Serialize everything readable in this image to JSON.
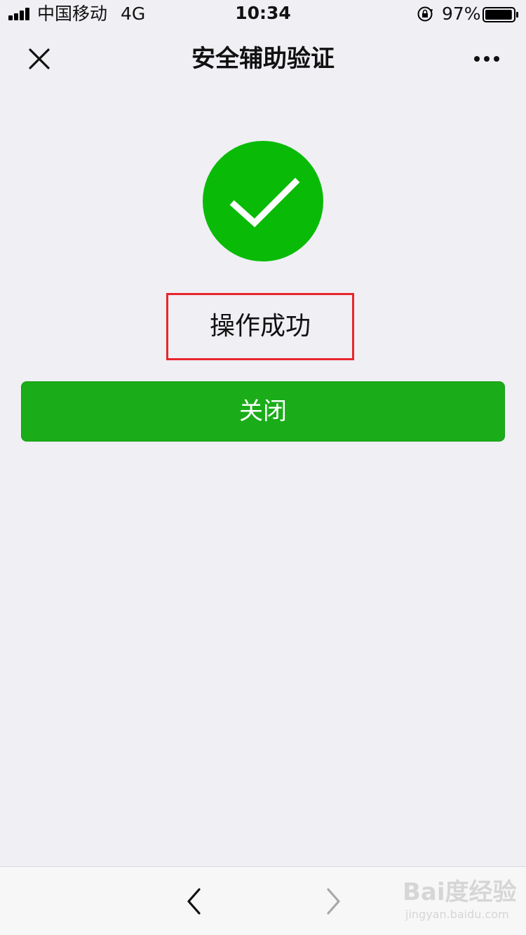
{
  "status_bar": {
    "carrier": "中国移动",
    "network": "4G",
    "time": "10:34",
    "battery_percent": "97%",
    "battery_level": 0.97
  },
  "nav": {
    "title": "安全辅助验证",
    "close_icon": "close-icon",
    "more_icon": "more-icon"
  },
  "result": {
    "icon": "success-check-icon",
    "message": "操作成功",
    "highlight_color": "#e8262c"
  },
  "actions": {
    "close_label": "关闭",
    "button_color": "#1aad19"
  },
  "bottom_bar": {
    "back_icon": "chevron-left-icon",
    "forward_icon": "chevron-right-icon"
  },
  "watermark": {
    "main": "Bai度经验",
    "sub": "jingyan.baidu.com"
  },
  "colors": {
    "background": "#efeff4",
    "success_green": "#09bb07"
  }
}
